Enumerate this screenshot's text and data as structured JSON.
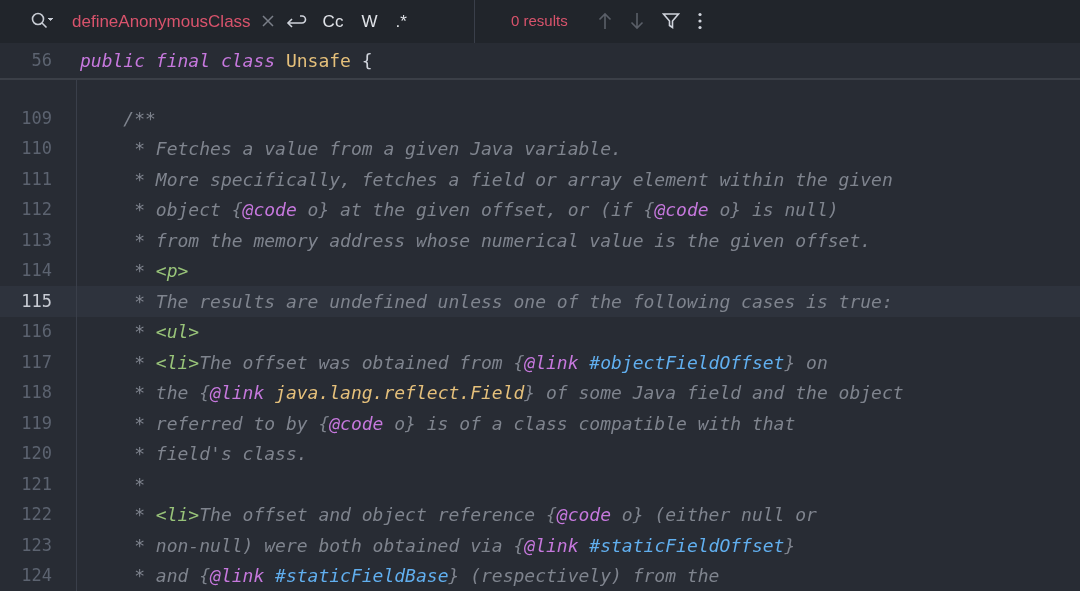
{
  "search": {
    "query": "defineAnonymousClass",
    "results": "0 results",
    "options": [
      {
        "label": "Cc",
        "selected": false
      },
      {
        "label": "W",
        "selected": false
      },
      {
        "label": ".*",
        "selected": false
      }
    ],
    "nav": [
      {
        "kind": "up",
        "disabled": true
      },
      {
        "kind": "down",
        "disabled": true
      }
    ]
  },
  "sticky_line": {
    "number": "56",
    "tokens": [
      {
        "kind": "keyword",
        "text": "public final class "
      },
      {
        "kind": "class",
        "text": "Unsafe"
      },
      {
        "kind": "plain",
        "text": " {"
      }
    ]
  },
  "lines": [
    {
      "number": "109",
      "current": false,
      "tokens": [
        {
          "kind": "comment",
          "text": "    /**"
        }
      ]
    },
    {
      "number": "110",
      "current": false,
      "tokens": [
        {
          "kind": "comment",
          "text": "     * Fetches a value from a given Java variable."
        }
      ]
    },
    {
      "number": "111",
      "current": false,
      "tokens": [
        {
          "kind": "comment",
          "text": "     * More specifically, fetches a field or array element within the given"
        }
      ]
    },
    {
      "number": "112",
      "current": false,
      "tokens": [
        {
          "kind": "comment",
          "text": "     * object {"
        },
        {
          "kind": "doctag",
          "text": "@code"
        },
        {
          "kind": "comment",
          "text": " o} at the given offset, or (if {"
        },
        {
          "kind": "doctag",
          "text": "@code"
        },
        {
          "kind": "comment",
          "text": " o} is null)"
        }
      ]
    },
    {
      "number": "113",
      "current": false,
      "tokens": [
        {
          "kind": "comment",
          "text": "     * from the memory address whose numerical value is the given offset."
        }
      ]
    },
    {
      "number": "114",
      "current": false,
      "tokens": [
        {
          "kind": "comment",
          "text": "     * "
        },
        {
          "kind": "tag",
          "text": "<p>"
        }
      ]
    },
    {
      "number": "115",
      "current": true,
      "tokens": [
        {
          "kind": "comment",
          "text": "     * The results are undefined unless one of the following cases is true:"
        }
      ]
    },
    {
      "number": "116",
      "current": false,
      "tokens": [
        {
          "kind": "comment",
          "text": "     * "
        },
        {
          "kind": "tag",
          "text": "<ul>"
        }
      ]
    },
    {
      "number": "117",
      "current": false,
      "tokens": [
        {
          "kind": "comment",
          "text": "     * "
        },
        {
          "kind": "tag",
          "text": "<li>"
        },
        {
          "kind": "comment",
          "text": "The offset was obtained from {"
        },
        {
          "kind": "doctag",
          "text": "@link "
        },
        {
          "kind": "member-ref",
          "text": "#objectFieldOffset"
        },
        {
          "kind": "comment",
          "text": "} on"
        }
      ]
    },
    {
      "number": "118",
      "current": false,
      "tokens": [
        {
          "kind": "comment",
          "text": "     * the {"
        },
        {
          "kind": "doctag",
          "text": "@link "
        },
        {
          "kind": "type-ref",
          "text": "java.lang.reflect.Field"
        },
        {
          "kind": "comment",
          "text": "} of some Java field and the object"
        }
      ]
    },
    {
      "number": "119",
      "current": false,
      "tokens": [
        {
          "kind": "comment",
          "text": "     * referred to by {"
        },
        {
          "kind": "doctag",
          "text": "@code"
        },
        {
          "kind": "comment",
          "text": " o} is of a class compatible with that"
        }
      ]
    },
    {
      "number": "120",
      "current": false,
      "tokens": [
        {
          "kind": "comment",
          "text": "     * field's class."
        }
      ]
    },
    {
      "number": "121",
      "current": false,
      "tokens": [
        {
          "kind": "comment",
          "text": "     *"
        }
      ]
    },
    {
      "number": "122",
      "current": false,
      "tokens": [
        {
          "kind": "comment",
          "text": "     * "
        },
        {
          "kind": "tag",
          "text": "<li>"
        },
        {
          "kind": "comment",
          "text": "The offset and object reference {"
        },
        {
          "kind": "doctag",
          "text": "@code"
        },
        {
          "kind": "comment",
          "text": " o} (either null or"
        }
      ]
    },
    {
      "number": "123",
      "current": false,
      "tokens": [
        {
          "kind": "comment",
          "text": "     * non-null) were both obtained via {"
        },
        {
          "kind": "doctag",
          "text": "@link "
        },
        {
          "kind": "member-ref",
          "text": "#staticFieldOffset"
        },
        {
          "kind": "comment",
          "text": "}"
        }
      ]
    },
    {
      "number": "124",
      "current": false,
      "tokens": [
        {
          "kind": "comment",
          "text": "     * and {"
        },
        {
          "kind": "doctag",
          "text": "@link "
        },
        {
          "kind": "member-ref",
          "text": "#staticFieldBase"
        },
        {
          "kind": "comment",
          "text": "} (respectively) from the"
        }
      ]
    }
  ]
}
